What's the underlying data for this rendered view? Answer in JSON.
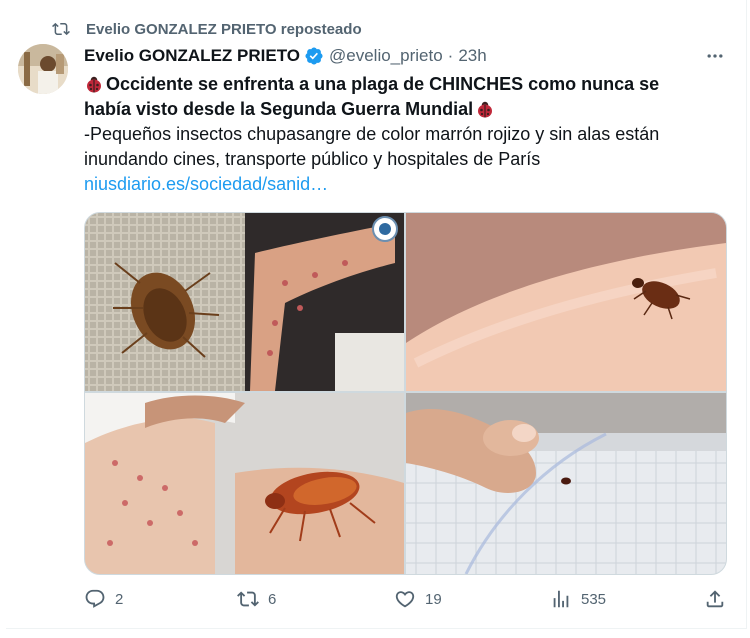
{
  "social_context": {
    "text": "Evelio GONZALEZ PRIETO reposteado",
    "icon": "repost-icon"
  },
  "author": {
    "name": "Evelio GONZALEZ PRIETO",
    "handle": "@evelio_prieto",
    "separator": "·",
    "time": "23h",
    "verified": true
  },
  "tweet": {
    "headline_line1": "Occidente se enfrenta a una plaga de CHINCHES como nunca se",
    "headline_line2": "había visto desde la Segunda Guerra Mundial",
    "body_line1": "-Pequeños insectos chupasangre de color marrón rojizo y sin alas están",
    "body_line2": "inundando cines, transporte público y hospitales de París",
    "link": "niusdiario.es/sociedad/sanid…",
    "emoji": "ladybug-icon"
  },
  "media": [
    {
      "description": "bed bug on fabric and arm with bites"
    },
    {
      "description": "bed bug on skin"
    },
    {
      "description": "back with bites and bed bug"
    },
    {
      "description": "fingers pointing at bug on mattress"
    }
  ],
  "actions": {
    "replies": "2",
    "reposts": "6",
    "likes": "19",
    "views": "535"
  },
  "colors": {
    "link": "#1d9bf0",
    "secondary": "#536471",
    "verified": "#1d9bf0"
  }
}
